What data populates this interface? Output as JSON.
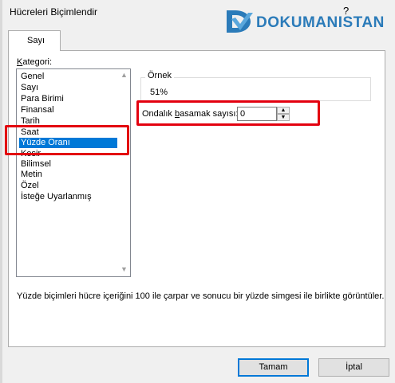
{
  "window": {
    "title": "Hücreleri Biçimlendir",
    "help": "?"
  },
  "logo": {
    "text": "DOKUMANISTAN"
  },
  "tabs": [
    {
      "label": "Sayı"
    }
  ],
  "kategori": {
    "label_underlined": "K",
    "label_rest": "ategori:",
    "items": [
      {
        "label": "Genel"
      },
      {
        "label": "Sayı"
      },
      {
        "label": "Para Birimi"
      },
      {
        "label": "Finansal"
      },
      {
        "label": "Tarih"
      },
      {
        "label": "Saat"
      },
      {
        "label": "Yüzde Oranı"
      },
      {
        "label": "Kesir"
      },
      {
        "label": "Bilimsel"
      },
      {
        "label": "Metin"
      },
      {
        "label": "Özel"
      },
      {
        "label": "İsteğe Uyarlanmış"
      }
    ],
    "selected": "Yüzde Oranı"
  },
  "sample": {
    "legend": "Örnek",
    "value": "51%"
  },
  "decimal": {
    "label_pre": "Ondalık ",
    "label_underlined": "b",
    "label_post": "asamak sayısı:",
    "value": "0"
  },
  "description": "Yüzde biçimleri hücre içeriğini 100 ile çarpar ve sonucu bir yüzde simgesi ile birlikte görüntüler.",
  "buttons": {
    "ok": "Tamam",
    "cancel": "İptal"
  },
  "colors": {
    "highlight": "#e3000f",
    "selection": "#0078d7",
    "logo": "#2b7bb9"
  }
}
